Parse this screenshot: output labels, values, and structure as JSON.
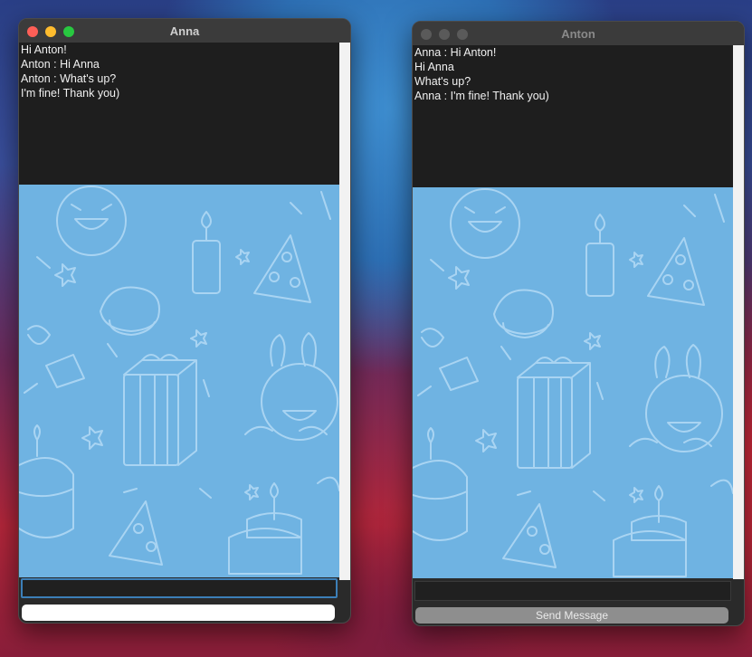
{
  "windows": [
    {
      "title": "Anna",
      "messages": [
        "Hi Anton!",
        "Anton : Hi Anna",
        "Anton : What's up?",
        "I'm fine! Thank you)"
      ],
      "input_value": "",
      "send_button_label": ""
    },
    {
      "title": "Anton",
      "messages": [
        "Anna : Hi Anton!",
        "Hi Anna",
        "What's up?",
        "Anna : I'm fine! Thank you)"
      ],
      "input_value": "",
      "send_button_label": "Send Message"
    }
  ],
  "colors": {
    "chat_background": "#1e1e1e",
    "wallpaper": "#6fb3e2",
    "wallpaper_lines": "#a9d4f2",
    "focus_ring": "#3c7fb8"
  }
}
